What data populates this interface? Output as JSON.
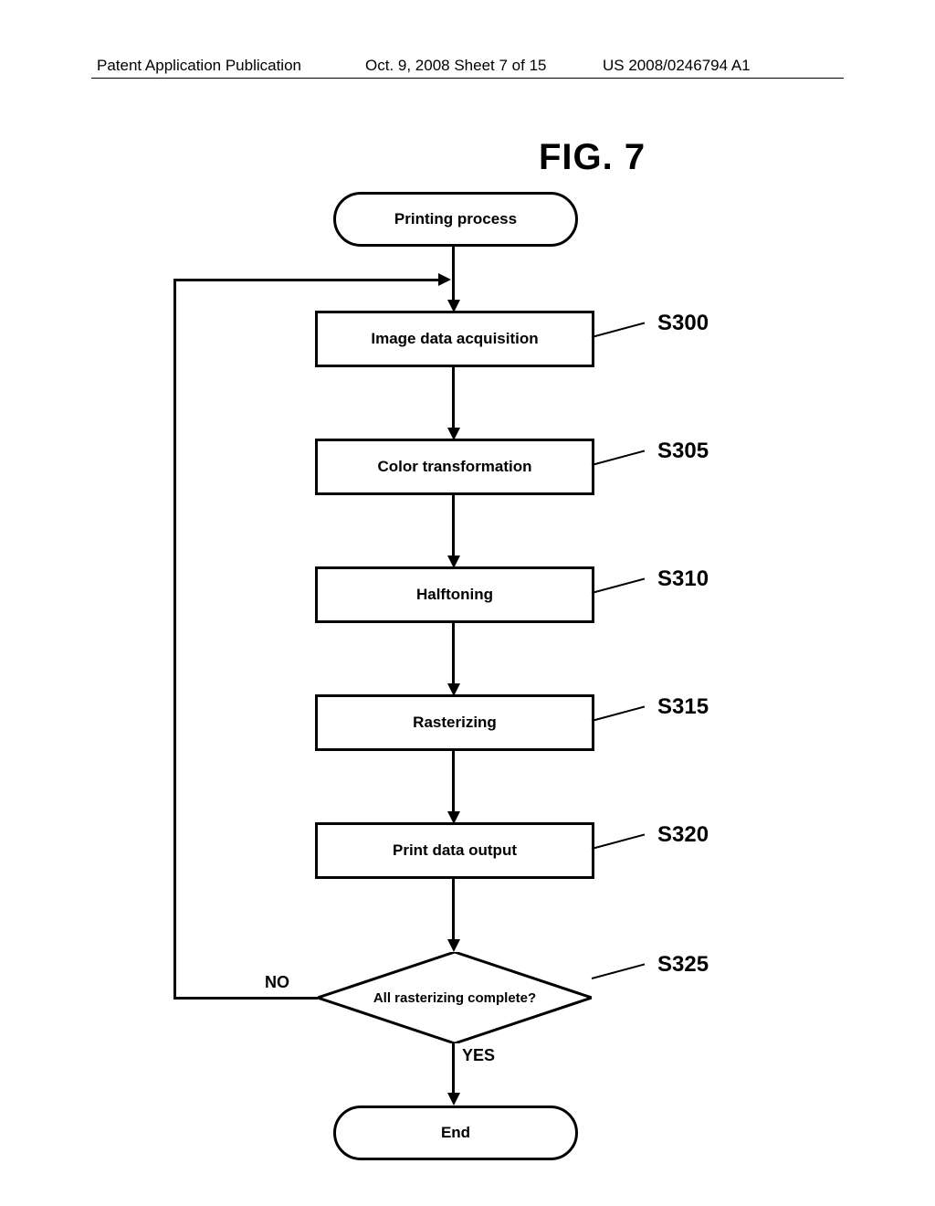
{
  "header": {
    "left": "Patent Application Publication",
    "center": "Oct. 9, 2008   Sheet 7 of 15",
    "right": "US 2008/0246794 A1"
  },
  "figure_label": "FIG. 7",
  "flowchart": {
    "start": "Printing process",
    "end": "End",
    "steps": {
      "s300": {
        "text": "Image data acquisition",
        "label": "S300"
      },
      "s305": {
        "text": "Color transformation",
        "label": "S305"
      },
      "s310": {
        "text": "Halftoning",
        "label": "S310"
      },
      "s315": {
        "text": "Rasterizing",
        "label": "S315"
      },
      "s320": {
        "text": "Print data output",
        "label": "S320"
      },
      "s325": {
        "text": "All rasterizing complete?",
        "label": "S325"
      }
    },
    "branches": {
      "no": "NO",
      "yes": "YES"
    }
  }
}
